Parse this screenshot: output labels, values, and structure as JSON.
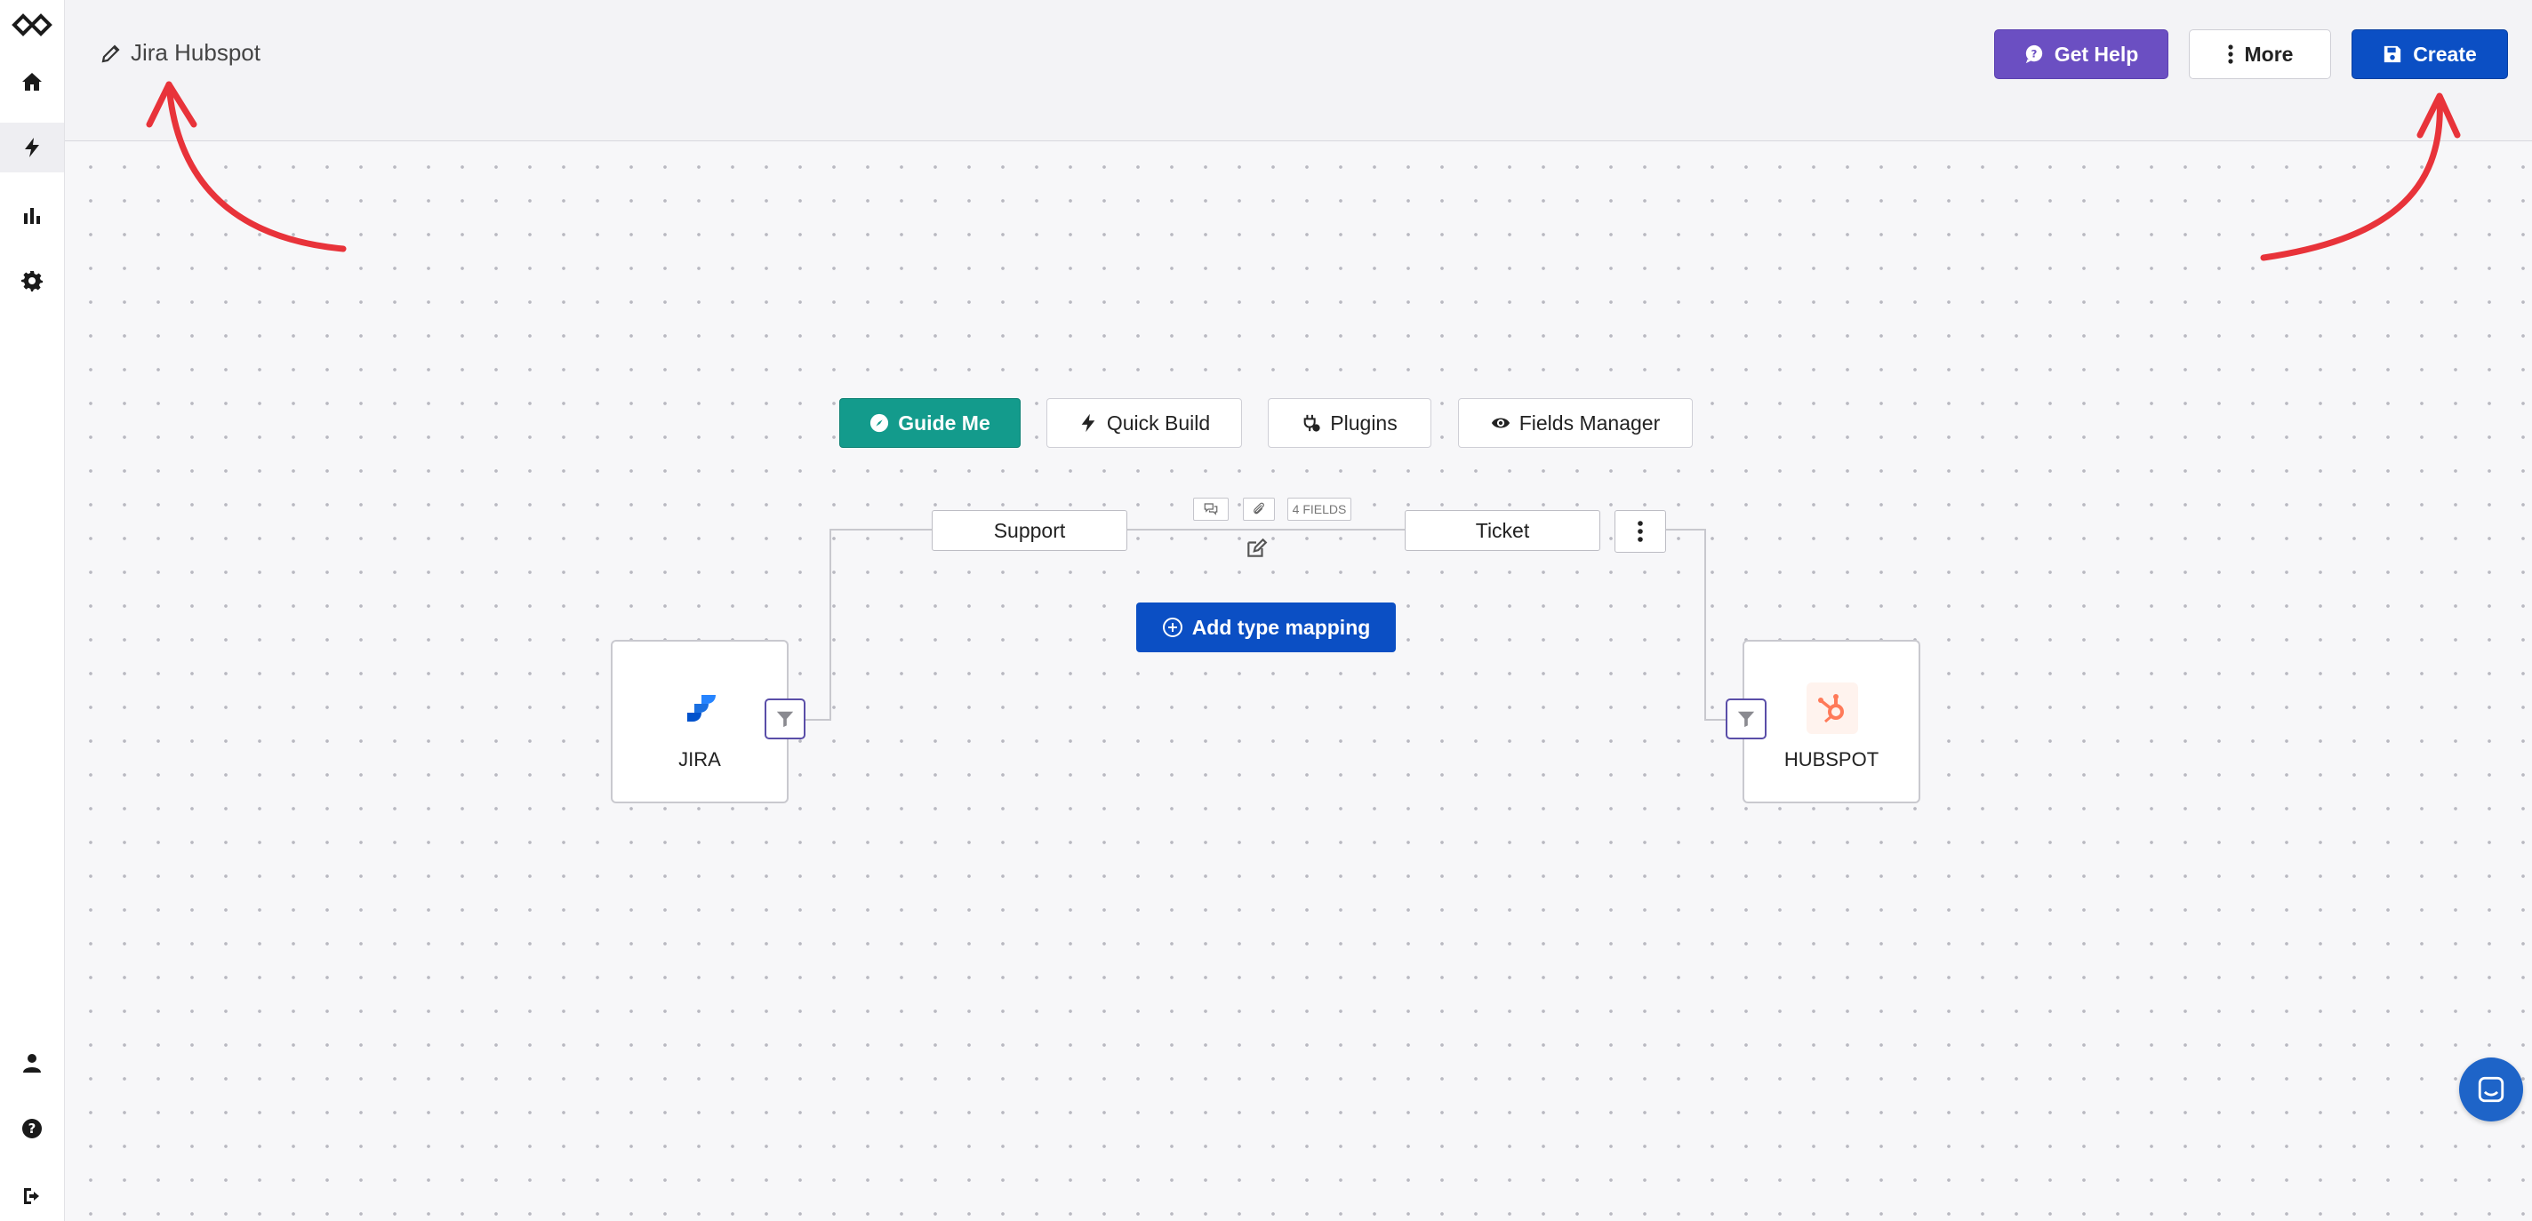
{
  "header": {
    "title": "Jira Hubspot",
    "buttons": {
      "help": "Get Help",
      "more": "More",
      "create": "Create"
    }
  },
  "sidebar": {
    "items": [
      "logo-icon",
      "home-icon",
      "bolt-icon",
      "bar-chart-icon",
      "gear-icon"
    ],
    "bottom": [
      "user-icon",
      "help-icon",
      "logout-icon"
    ],
    "active": "bolt-icon"
  },
  "toolbar": {
    "guide_me": "Guide Me",
    "quick_build": "Quick Build",
    "plugins": "Plugins",
    "fields_manager": "Fields Manager"
  },
  "mapping": {
    "source_type": "Support",
    "target_type": "Ticket",
    "fields_badge": "4 FIELDS",
    "add_button": "Add type mapping"
  },
  "nodes": {
    "source": "JIRA",
    "target": "HUBSPOT"
  },
  "colors": {
    "help_button": "#6b4fc2",
    "create_button": "#0b4fc4",
    "guide_button": "#139b8c",
    "annotation_arrow": "#e8333a",
    "filter_border": "#5a4ea8"
  }
}
